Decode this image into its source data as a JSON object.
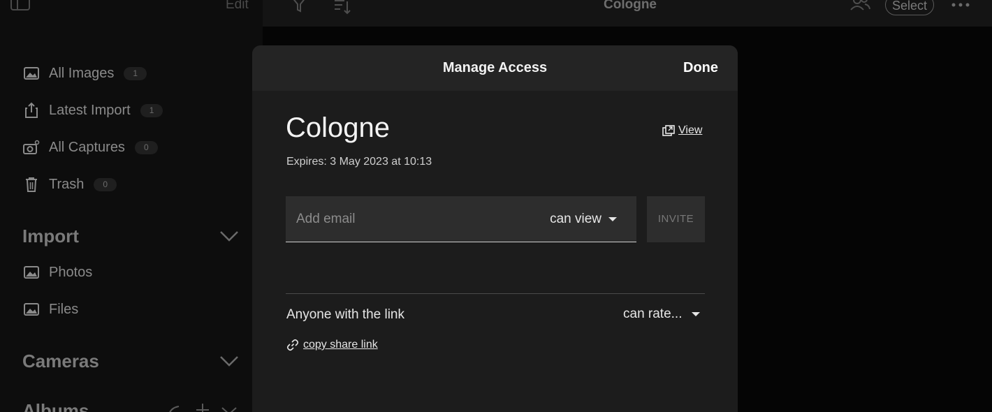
{
  "sidebar": {
    "edit_label": "Edit",
    "items": [
      {
        "label": "All Images",
        "count": "1",
        "icon": "image-icon"
      },
      {
        "label": "Latest Import",
        "count": "1",
        "icon": "import-icon"
      },
      {
        "label": "All Captures",
        "count": "0",
        "icon": "camera-icon"
      },
      {
        "label": "Trash",
        "count": "0",
        "icon": "trash-icon"
      }
    ],
    "sections": {
      "import": {
        "title": "Import",
        "items": [
          {
            "label": "Photos"
          },
          {
            "label": "Files"
          }
        ]
      },
      "cameras": {
        "title": "Cameras"
      },
      "albums": {
        "title": "Albums"
      }
    }
  },
  "topbar": {
    "title": "Cologne",
    "select_label": "Select"
  },
  "modal": {
    "title": "Manage Access",
    "done_label": "Done",
    "album_name": "Cologne",
    "view_label": "View",
    "expires": "Expires: 3 May 2023 at 10:13",
    "email_placeholder": "Add email",
    "email_permission": "can view",
    "invite_label": "INVITE",
    "anyone_label": "Anyone with the link",
    "link_permission": "can rate...",
    "copy_link_label": "copy share link"
  },
  "colors": {
    "modal_bg": "#1c1c1c",
    "modal_header_bg": "#242424",
    "field_bg": "#2d2d2d",
    "sidebar_bg": "#0d0d0d"
  }
}
